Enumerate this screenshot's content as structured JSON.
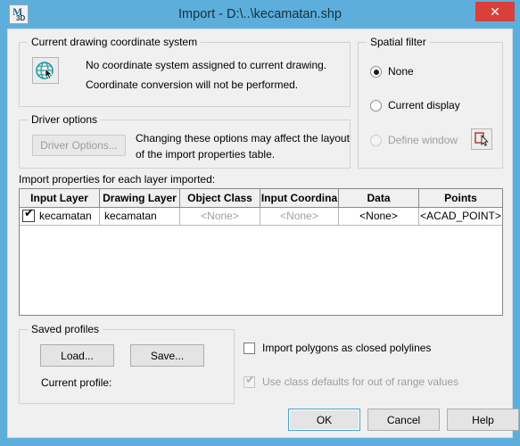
{
  "window": {
    "title": "Import - D:\\..\\kecamatan.shp",
    "app_icon": {
      "primary": "M",
      "secondary": "3D",
      "name": "autocad-map3d-icon"
    },
    "close_label": "✕"
  },
  "coordinate_system": {
    "legend": "Current drawing coordinate system",
    "line1": "No coordinate system assigned to current drawing.",
    "line2": "Coordinate conversion will not be performed.",
    "icon": "globe-icon"
  },
  "driver_options": {
    "legend": "Driver options",
    "button_label": "Driver Options...",
    "line1": "Changing these options may affect the layout",
    "line2": "of the import properties table."
  },
  "spatial_filter": {
    "legend": "Spatial filter",
    "options": [
      {
        "label": "None",
        "checked": true,
        "disabled": false
      },
      {
        "label": "Current display",
        "checked": false,
        "disabled": false
      },
      {
        "label": "Define window",
        "checked": false,
        "disabled": true
      }
    ],
    "define_window_button_icon": "select-window-icon"
  },
  "import_properties": {
    "caption": "Import properties for each layer imported:",
    "columns": [
      "Input Layer",
      "Drawing Layer",
      "Object Class",
      "Input Coordina",
      "Data",
      "Points"
    ],
    "rows": [
      {
        "checked": true,
        "input_layer": "kecamatan",
        "drawing_layer": "kecamatan",
        "object_class": "<None>",
        "object_class_dim": true,
        "input_coordinate": "<None>",
        "input_coordinate_dim": true,
        "data": "<None>",
        "data_dim": false,
        "points": "<ACAD_POINT>",
        "points_dim": false
      }
    ]
  },
  "saved_profiles": {
    "legend": "Saved profiles",
    "load_label": "Load...",
    "save_label": "Save...",
    "current_profile_label": "Current profile:",
    "current_profile_value": ""
  },
  "options": [
    {
      "label": "Import polygons as closed polylines",
      "checked": false,
      "disabled": false
    },
    {
      "label": "Use class defaults for out of range values",
      "checked": true,
      "disabled": true
    }
  ],
  "footer": {
    "ok_label": "OK",
    "cancel_label": "Cancel",
    "help_label": "Help"
  },
  "colors": {
    "title_bar": "#5daedb",
    "close_button": "#d8403c",
    "dialog_face": "#f0f0f0",
    "globe": "#1f9e9a",
    "focus_border": "#4a9fd4",
    "disabled_text": "#9d9d9d"
  }
}
